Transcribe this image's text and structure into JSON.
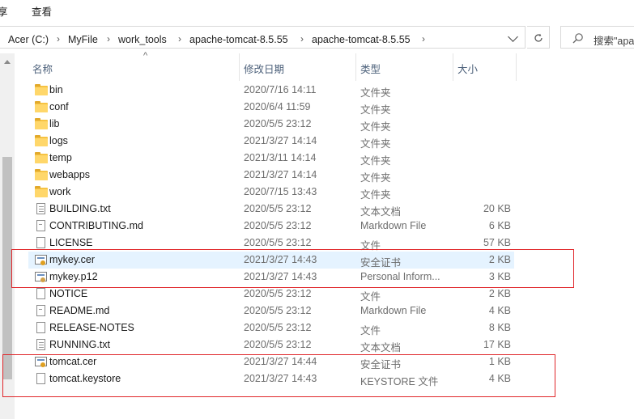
{
  "menu": {
    "item1": "享",
    "item2": "查看"
  },
  "address": {
    "crumbs": [
      "Acer (C:)",
      "MyFile",
      "work_tools",
      "apache-tomcat-8.5.55",
      "apache-tomcat-8.5.55"
    ],
    "search_placeholder": "搜索\"apa"
  },
  "columns": {
    "name": "名称",
    "date": "修改日期",
    "type": "类型",
    "size": "大小"
  },
  "files": [
    {
      "name": "bin",
      "date": "2020/7/16 14:11",
      "type": "文件夹",
      "size": "",
      "icon": "folder-icon"
    },
    {
      "name": "conf",
      "date": "2020/6/4 11:59",
      "type": "文件夹",
      "size": "",
      "icon": "folder-icon"
    },
    {
      "name": "lib",
      "date": "2020/5/5 23:12",
      "type": "文件夹",
      "size": "",
      "icon": "folder-icon"
    },
    {
      "name": "logs",
      "date": "2021/3/27 14:14",
      "type": "文件夹",
      "size": "",
      "icon": "folder-icon"
    },
    {
      "name": "temp",
      "date": "2021/3/11 14:14",
      "type": "文件夹",
      "size": "",
      "icon": "folder-icon"
    },
    {
      "name": "webapps",
      "date": "2021/3/27 14:14",
      "type": "文件夹",
      "size": "",
      "icon": "folder-icon"
    },
    {
      "name": "work",
      "date": "2020/7/15 13:43",
      "type": "文件夹",
      "size": "",
      "icon": "folder-icon"
    },
    {
      "name": "BUILDING.txt",
      "date": "2020/5/5 23:12",
      "type": "文本文档",
      "size": "20 KB",
      "icon": "text-file-icon"
    },
    {
      "name": "CONTRIBUTING.md",
      "date": "2020/5/5 23:12",
      "type": "Markdown File",
      "size": "6 KB",
      "icon": "markdown-file-icon"
    },
    {
      "name": "LICENSE",
      "date": "2020/5/5 23:12",
      "type": "文件",
      "size": "57 KB",
      "icon": "file-icon"
    },
    {
      "name": "mykey.cer",
      "date": "2021/3/27 14:43",
      "type": "安全证书",
      "size": "2 KB",
      "icon": "certificate-icon"
    },
    {
      "name": "mykey.p12",
      "date": "2021/3/27 14:43",
      "type": "Personal Inform...",
      "size": "3 KB",
      "icon": "personal-info-exchange-icon"
    },
    {
      "name": "NOTICE",
      "date": "2020/5/5 23:12",
      "type": "文件",
      "size": "2 KB",
      "icon": "file-icon"
    },
    {
      "name": "README.md",
      "date": "2020/5/5 23:12",
      "type": "Markdown File",
      "size": "4 KB",
      "icon": "markdown-file-icon"
    },
    {
      "name": "RELEASE-NOTES",
      "date": "2020/5/5 23:12",
      "type": "文件",
      "size": "8 KB",
      "icon": "file-icon"
    },
    {
      "name": "RUNNING.txt",
      "date": "2020/5/5 23:12",
      "type": "文本文档",
      "size": "17 KB",
      "icon": "text-file-icon"
    },
    {
      "name": "tomcat.cer",
      "date": "2021/3/27 14:44",
      "type": "安全证书",
      "size": "1 KB",
      "icon": "certificate-icon"
    },
    {
      "name": "tomcat.keystore",
      "date": "2021/3/27 14:43",
      "type": "KEYSTORE 文件",
      "size": "4 KB",
      "icon": "file-icon"
    }
  ],
  "selected_file": "mykey.cer",
  "colors": {
    "selection": "#e5f3ff",
    "highlight_box": "#e0262a",
    "folder": "#ffd76a"
  }
}
